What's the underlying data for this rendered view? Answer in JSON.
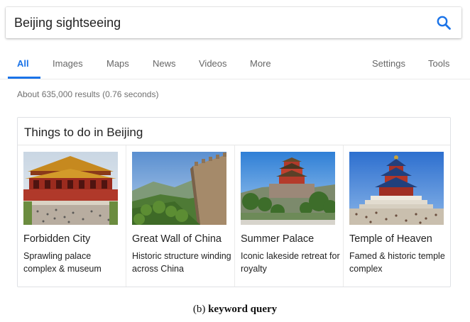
{
  "search": {
    "query": "Beijing sightseeing"
  },
  "tabs": [
    {
      "label": "All",
      "active": true
    },
    {
      "label": "Images"
    },
    {
      "label": "Maps"
    },
    {
      "label": "News"
    },
    {
      "label": "Videos"
    },
    {
      "label": "More"
    },
    {
      "label": "Settings"
    },
    {
      "label": "Tools"
    }
  ],
  "result_stats": "About 635,000 results (0.76 seconds)",
  "card": {
    "title": "Things to do in Beijing",
    "items": [
      {
        "title": "Forbidden City",
        "description": "Sprawling palace complex & museum"
      },
      {
        "title": "Great Wall of China",
        "description": "Historic structure winding across China"
      },
      {
        "title": "Summer Palace",
        "description": "Iconic lakeside retreat for royalty"
      },
      {
        "title": "Temple of Heaven",
        "description": "Famed & historic temple complex"
      }
    ]
  },
  "caption": {
    "prefix": "(b)",
    "text": "keyword query"
  },
  "colors": {
    "accent": "#1a73e8",
    "text": "#222222",
    "muted": "#707070"
  },
  "icons": {
    "search": "search-icon"
  }
}
